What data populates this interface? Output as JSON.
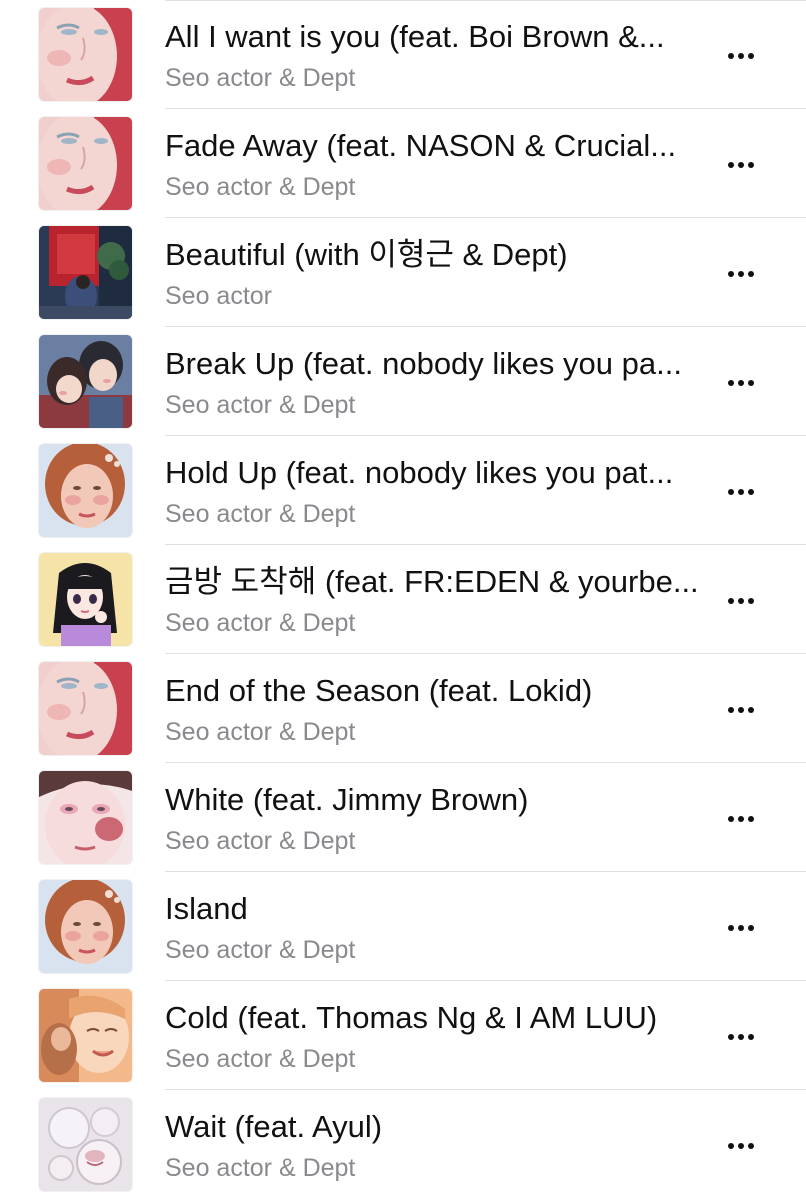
{
  "app": {
    "more_icon": "ellipsis-icon"
  },
  "colors": {
    "title_text": "#111111",
    "artist_text": "#8a8a8e",
    "divider": "#e0e0e2",
    "background": "#ffffff"
  },
  "tracks": [
    {
      "title": "All I want is you (feat. Boi Brown &...",
      "artist": "Seo actor & Dept",
      "artwork": "pink-face-art"
    },
    {
      "title": "Fade Away (feat. NASON & Crucial...",
      "artist": "Seo actor & Dept",
      "artwork": "pink-face-art"
    },
    {
      "title": "Beautiful (with 이형근 & Dept)",
      "artist": "Seo actor",
      "artwork": "red-room-art"
    },
    {
      "title": "Break Up (feat. nobody likes you pa...",
      "artist": "Seo actor & Dept",
      "artwork": "couple-art"
    },
    {
      "title": "Hold Up (feat. nobody likes you pat...",
      "artist": "Seo actor & Dept",
      "artwork": "redhead-girl-art"
    },
    {
      "title": "금방 도착해 (feat. FR:EDEN & yourbe...",
      "artist": "Seo actor & Dept",
      "artwork": "manga-girl-art"
    },
    {
      "title": "End of the Season (feat. Lokid)",
      "artist": "Seo actor & Dept",
      "artwork": "pink-face-art"
    },
    {
      "title": "White (feat. Jimmy Brown)",
      "artist": "Seo actor & Dept",
      "artwork": "blush-face-art"
    },
    {
      "title": "Island",
      "artist": "Seo actor & Dept",
      "artwork": "redhead-girl-art"
    },
    {
      "title": "Cold (feat. Thomas Ng & I AM LUU)",
      "artist": "Seo actor & Dept",
      "artwork": "warm-faces-art"
    },
    {
      "title": "Wait (feat. Ayul)",
      "artist": "Seo actor & Dept",
      "artwork": "crystal-art"
    }
  ]
}
